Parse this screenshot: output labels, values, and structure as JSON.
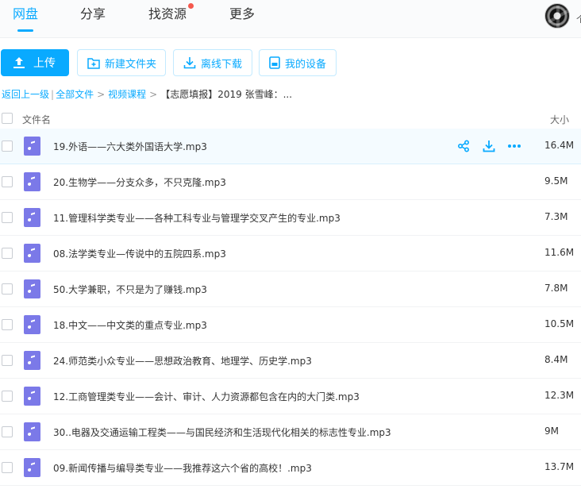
{
  "nav": {
    "tabs": [
      {
        "label": "网盘",
        "active": true
      },
      {
        "label": "分享",
        "active": false
      },
      {
        "label": "找资源",
        "active": false,
        "badge": true
      },
      {
        "label": "更多",
        "active": false
      }
    ],
    "avatar_edge_text": "个"
  },
  "toolbar": {
    "upload_label": "上传",
    "new_folder_label": "新建文件夹",
    "offline_download_label": "离线下载",
    "my_devices_label": "我的设备"
  },
  "breadcrumb": {
    "back": "返回上一级",
    "all_files": "全部文件",
    "folder": "视频课程",
    "current": "【志愿填报】2019 张雪峰：..."
  },
  "table": {
    "col_name": "文件名",
    "col_size": "大小",
    "rows": [
      {
        "name": "19.外语——六大类外国语大学.mp3",
        "size": "16.4M",
        "hover": true
      },
      {
        "name": "20.生物学——分支众多，不只克隆.mp3",
        "size": "9.5M"
      },
      {
        "name": "11.管理科学类专业——各种工科专业与管理学交叉产生的专业.mp3",
        "size": "7.3M"
      },
      {
        "name": "08.法学类专业—传说中的五院四系.mp3",
        "size": "11.6M"
      },
      {
        "name": "50.大学兼职，不只是为了赚钱.mp3",
        "size": "7.8M"
      },
      {
        "name": "18.中文——中文类的重点专业.mp3",
        "size": "10.5M"
      },
      {
        "name": "24.师范类小众专业——思想政治教育、地理学、历史学.mp3",
        "size": "8.4M"
      },
      {
        "name": "12.工商管理类专业——会计、审计、人力资源都包含在内的大门类.mp3",
        "size": "12.3M"
      },
      {
        "name": "30..电器及交通运输工程类——与国民经济和生活现代化相关的标志性专业.mp3",
        "size": "9M"
      },
      {
        "name": "09.新闻传播与编导类专业——我推荐这六个省的高校！.mp3",
        "size": "13.7M"
      }
    ]
  },
  "colors": {
    "accent": "#09aaff",
    "audio_icon": "#7b79e8",
    "badge": "#f5584d"
  }
}
